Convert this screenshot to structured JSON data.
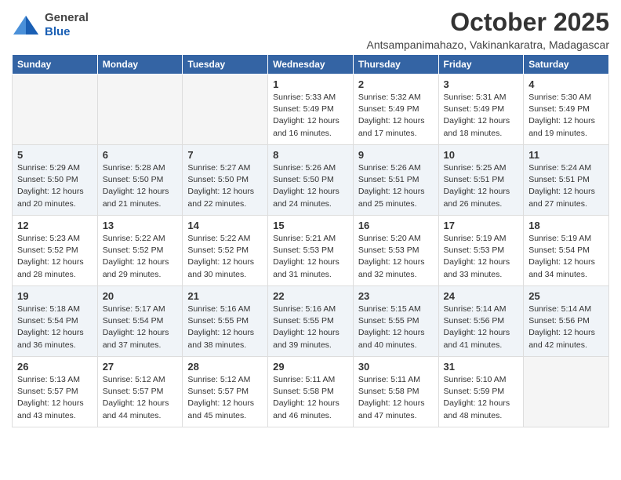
{
  "header": {
    "logo_general": "General",
    "logo_blue": "Blue",
    "month": "October 2025",
    "location": "Antsampanimahazo, Vakinankaratra, Madagascar"
  },
  "weekdays": [
    "Sunday",
    "Monday",
    "Tuesday",
    "Wednesday",
    "Thursday",
    "Friday",
    "Saturday"
  ],
  "weeks": [
    [
      {
        "day": "",
        "info": ""
      },
      {
        "day": "",
        "info": ""
      },
      {
        "day": "",
        "info": ""
      },
      {
        "day": "1",
        "info": "Sunrise: 5:33 AM\nSunset: 5:49 PM\nDaylight: 12 hours\nand 16 minutes."
      },
      {
        "day": "2",
        "info": "Sunrise: 5:32 AM\nSunset: 5:49 PM\nDaylight: 12 hours\nand 17 minutes."
      },
      {
        "day": "3",
        "info": "Sunrise: 5:31 AM\nSunset: 5:49 PM\nDaylight: 12 hours\nand 18 minutes."
      },
      {
        "day": "4",
        "info": "Sunrise: 5:30 AM\nSunset: 5:49 PM\nDaylight: 12 hours\nand 19 minutes."
      }
    ],
    [
      {
        "day": "5",
        "info": "Sunrise: 5:29 AM\nSunset: 5:50 PM\nDaylight: 12 hours\nand 20 minutes."
      },
      {
        "day": "6",
        "info": "Sunrise: 5:28 AM\nSunset: 5:50 PM\nDaylight: 12 hours\nand 21 minutes."
      },
      {
        "day": "7",
        "info": "Sunrise: 5:27 AM\nSunset: 5:50 PM\nDaylight: 12 hours\nand 22 minutes."
      },
      {
        "day": "8",
        "info": "Sunrise: 5:26 AM\nSunset: 5:50 PM\nDaylight: 12 hours\nand 24 minutes."
      },
      {
        "day": "9",
        "info": "Sunrise: 5:26 AM\nSunset: 5:51 PM\nDaylight: 12 hours\nand 25 minutes."
      },
      {
        "day": "10",
        "info": "Sunrise: 5:25 AM\nSunset: 5:51 PM\nDaylight: 12 hours\nand 26 minutes."
      },
      {
        "day": "11",
        "info": "Sunrise: 5:24 AM\nSunset: 5:51 PM\nDaylight: 12 hours\nand 27 minutes."
      }
    ],
    [
      {
        "day": "12",
        "info": "Sunrise: 5:23 AM\nSunset: 5:52 PM\nDaylight: 12 hours\nand 28 minutes."
      },
      {
        "day": "13",
        "info": "Sunrise: 5:22 AM\nSunset: 5:52 PM\nDaylight: 12 hours\nand 29 minutes."
      },
      {
        "day": "14",
        "info": "Sunrise: 5:22 AM\nSunset: 5:52 PM\nDaylight: 12 hours\nand 30 minutes."
      },
      {
        "day": "15",
        "info": "Sunrise: 5:21 AM\nSunset: 5:53 PM\nDaylight: 12 hours\nand 31 minutes."
      },
      {
        "day": "16",
        "info": "Sunrise: 5:20 AM\nSunset: 5:53 PM\nDaylight: 12 hours\nand 32 minutes."
      },
      {
        "day": "17",
        "info": "Sunrise: 5:19 AM\nSunset: 5:53 PM\nDaylight: 12 hours\nand 33 minutes."
      },
      {
        "day": "18",
        "info": "Sunrise: 5:19 AM\nSunset: 5:54 PM\nDaylight: 12 hours\nand 34 minutes."
      }
    ],
    [
      {
        "day": "19",
        "info": "Sunrise: 5:18 AM\nSunset: 5:54 PM\nDaylight: 12 hours\nand 36 minutes."
      },
      {
        "day": "20",
        "info": "Sunrise: 5:17 AM\nSunset: 5:54 PM\nDaylight: 12 hours\nand 37 minutes."
      },
      {
        "day": "21",
        "info": "Sunrise: 5:16 AM\nSunset: 5:55 PM\nDaylight: 12 hours\nand 38 minutes."
      },
      {
        "day": "22",
        "info": "Sunrise: 5:16 AM\nSunset: 5:55 PM\nDaylight: 12 hours\nand 39 minutes."
      },
      {
        "day": "23",
        "info": "Sunrise: 5:15 AM\nSunset: 5:55 PM\nDaylight: 12 hours\nand 40 minutes."
      },
      {
        "day": "24",
        "info": "Sunrise: 5:14 AM\nSunset: 5:56 PM\nDaylight: 12 hours\nand 41 minutes."
      },
      {
        "day": "25",
        "info": "Sunrise: 5:14 AM\nSunset: 5:56 PM\nDaylight: 12 hours\nand 42 minutes."
      }
    ],
    [
      {
        "day": "26",
        "info": "Sunrise: 5:13 AM\nSunset: 5:57 PM\nDaylight: 12 hours\nand 43 minutes."
      },
      {
        "day": "27",
        "info": "Sunrise: 5:12 AM\nSunset: 5:57 PM\nDaylight: 12 hours\nand 44 minutes."
      },
      {
        "day": "28",
        "info": "Sunrise: 5:12 AM\nSunset: 5:57 PM\nDaylight: 12 hours\nand 45 minutes."
      },
      {
        "day": "29",
        "info": "Sunrise: 5:11 AM\nSunset: 5:58 PM\nDaylight: 12 hours\nand 46 minutes."
      },
      {
        "day": "30",
        "info": "Sunrise: 5:11 AM\nSunset: 5:58 PM\nDaylight: 12 hours\nand 47 minutes."
      },
      {
        "day": "31",
        "info": "Sunrise: 5:10 AM\nSunset: 5:59 PM\nDaylight: 12 hours\nand 48 minutes."
      },
      {
        "day": "",
        "info": ""
      }
    ]
  ]
}
